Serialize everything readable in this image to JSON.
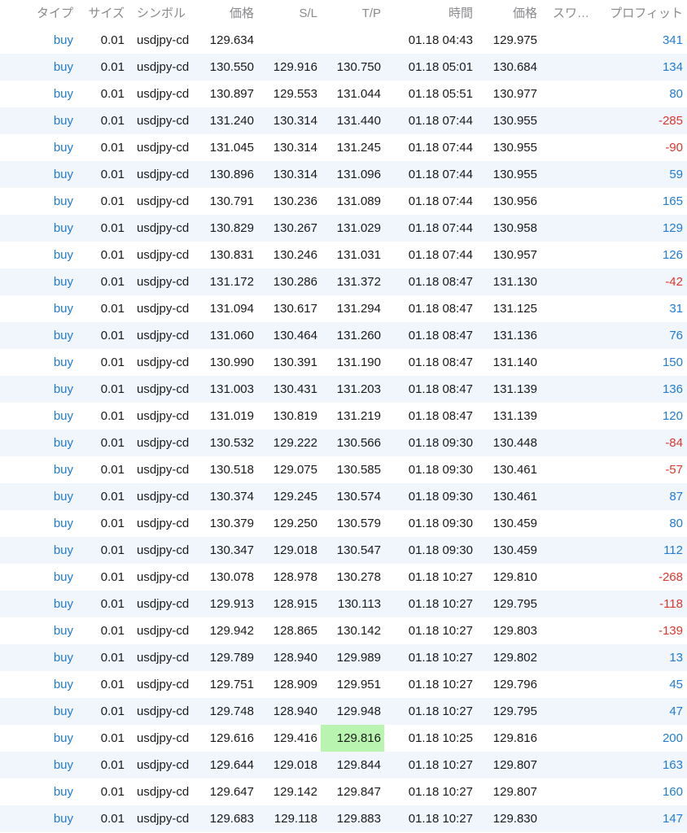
{
  "header": {
    "type": "タイプ",
    "size": "サイズ",
    "symbol": "シンボル",
    "price": "価格",
    "sl": "S/L",
    "tp": "T/P",
    "time": "時間",
    "current_price": "価格",
    "swap": "スワ…",
    "profit": "プロフィット"
  },
  "colors": {
    "buy": "#1f7bd6",
    "profit_positive": "#1f7bd6",
    "profit_negative": "#e0362c",
    "row_alternate": "#f1f6fd",
    "tp_highlight": "#b9f5b0"
  },
  "rows": [
    {
      "type": "buy",
      "size": "0.01",
      "symbol": "usdjpy-cd",
      "price": "129.634",
      "sl": "",
      "tp": "",
      "time": "01.18 04:43",
      "current_price": "129.975",
      "swap": "",
      "profit": "341"
    },
    {
      "type": "buy",
      "size": "0.01",
      "symbol": "usdjpy-cd",
      "price": "130.550",
      "sl": "129.916",
      "tp": "130.750",
      "time": "01.18 05:01",
      "current_price": "130.684",
      "swap": "",
      "profit": "134"
    },
    {
      "type": "buy",
      "size": "0.01",
      "symbol": "usdjpy-cd",
      "price": "130.897",
      "sl": "129.553",
      "tp": "131.044",
      "time": "01.18 05:51",
      "current_price": "130.977",
      "swap": "",
      "profit": "80"
    },
    {
      "type": "buy",
      "size": "0.01",
      "symbol": "usdjpy-cd",
      "price": "131.240",
      "sl": "130.314",
      "tp": "131.440",
      "time": "01.18 07:44",
      "current_price": "130.955",
      "swap": "",
      "profit": "-285"
    },
    {
      "type": "buy",
      "size": "0.01",
      "symbol": "usdjpy-cd",
      "price": "131.045",
      "sl": "130.314",
      "tp": "131.245",
      "time": "01.18 07:44",
      "current_price": "130.955",
      "swap": "",
      "profit": "-90"
    },
    {
      "type": "buy",
      "size": "0.01",
      "symbol": "usdjpy-cd",
      "price": "130.896",
      "sl": "130.314",
      "tp": "131.096",
      "time": "01.18 07:44",
      "current_price": "130.955",
      "swap": "",
      "profit": "59"
    },
    {
      "type": "buy",
      "size": "0.01",
      "symbol": "usdjpy-cd",
      "price": "130.791",
      "sl": "130.236",
      "tp": "131.089",
      "time": "01.18 07:44",
      "current_price": "130.956",
      "swap": "",
      "profit": "165"
    },
    {
      "type": "buy",
      "size": "0.01",
      "symbol": "usdjpy-cd",
      "price": "130.829",
      "sl": "130.267",
      "tp": "131.029",
      "time": "01.18 07:44",
      "current_price": "130.958",
      "swap": "",
      "profit": "129"
    },
    {
      "type": "buy",
      "size": "0.01",
      "symbol": "usdjpy-cd",
      "price": "130.831",
      "sl": "130.246",
      "tp": "131.031",
      "time": "01.18 07:44",
      "current_price": "130.957",
      "swap": "",
      "profit": "126"
    },
    {
      "type": "buy",
      "size": "0.01",
      "symbol": "usdjpy-cd",
      "price": "131.172",
      "sl": "130.286",
      "tp": "131.372",
      "time": "01.18 08:47",
      "current_price": "131.130",
      "swap": "",
      "profit": "-42"
    },
    {
      "type": "buy",
      "size": "0.01",
      "symbol": "usdjpy-cd",
      "price": "131.094",
      "sl": "130.617",
      "tp": "131.294",
      "time": "01.18 08:47",
      "current_price": "131.125",
      "swap": "",
      "profit": "31"
    },
    {
      "type": "buy",
      "size": "0.01",
      "symbol": "usdjpy-cd",
      "price": "131.060",
      "sl": "130.464",
      "tp": "131.260",
      "time": "01.18 08:47",
      "current_price": "131.136",
      "swap": "",
      "profit": "76"
    },
    {
      "type": "buy",
      "size": "0.01",
      "symbol": "usdjpy-cd",
      "price": "130.990",
      "sl": "130.391",
      "tp": "131.190",
      "time": "01.18 08:47",
      "current_price": "131.140",
      "swap": "",
      "profit": "150"
    },
    {
      "type": "buy",
      "size": "0.01",
      "symbol": "usdjpy-cd",
      "price": "131.003",
      "sl": "130.431",
      "tp": "131.203",
      "time": "01.18 08:47",
      "current_price": "131.139",
      "swap": "",
      "profit": "136"
    },
    {
      "type": "buy",
      "size": "0.01",
      "symbol": "usdjpy-cd",
      "price": "131.019",
      "sl": "130.819",
      "tp": "131.219",
      "time": "01.18 08:47",
      "current_price": "131.139",
      "swap": "",
      "profit": "120"
    },
    {
      "type": "buy",
      "size": "0.01",
      "symbol": "usdjpy-cd",
      "price": "130.532",
      "sl": "129.222",
      "tp": "130.566",
      "time": "01.18 09:30",
      "current_price": "130.448",
      "swap": "",
      "profit": "-84"
    },
    {
      "type": "buy",
      "size": "0.01",
      "symbol": "usdjpy-cd",
      "price": "130.518",
      "sl": "129.075",
      "tp": "130.585",
      "time": "01.18 09:30",
      "current_price": "130.461",
      "swap": "",
      "profit": "-57"
    },
    {
      "type": "buy",
      "size": "0.01",
      "symbol": "usdjpy-cd",
      "price": "130.374",
      "sl": "129.245",
      "tp": "130.574",
      "time": "01.18 09:30",
      "current_price": "130.461",
      "swap": "",
      "profit": "87"
    },
    {
      "type": "buy",
      "size": "0.01",
      "symbol": "usdjpy-cd",
      "price": "130.379",
      "sl": "129.250",
      "tp": "130.579",
      "time": "01.18 09:30",
      "current_price": "130.459",
      "swap": "",
      "profit": "80"
    },
    {
      "type": "buy",
      "size": "0.01",
      "symbol": "usdjpy-cd",
      "price": "130.347",
      "sl": "129.018",
      "tp": "130.547",
      "time": "01.18 09:30",
      "current_price": "130.459",
      "swap": "",
      "profit": "112"
    },
    {
      "type": "buy",
      "size": "0.01",
      "symbol": "usdjpy-cd",
      "price": "130.078",
      "sl": "128.978",
      "tp": "130.278",
      "time": "01.18 10:27",
      "current_price": "129.810",
      "swap": "",
      "profit": "-268"
    },
    {
      "type": "buy",
      "size": "0.01",
      "symbol": "usdjpy-cd",
      "price": "129.913",
      "sl": "128.915",
      "tp": "130.113",
      "time": "01.18 10:27",
      "current_price": "129.795",
      "swap": "",
      "profit": "-118"
    },
    {
      "type": "buy",
      "size": "0.01",
      "symbol": "usdjpy-cd",
      "price": "129.942",
      "sl": "128.865",
      "tp": "130.142",
      "time": "01.18 10:27",
      "current_price": "129.803",
      "swap": "",
      "profit": "-139"
    },
    {
      "type": "buy",
      "size": "0.01",
      "symbol": "usdjpy-cd",
      "price": "129.789",
      "sl": "128.940",
      "tp": "129.989",
      "time": "01.18 10:27",
      "current_price": "129.802",
      "swap": "",
      "profit": "13"
    },
    {
      "type": "buy",
      "size": "0.01",
      "symbol": "usdjpy-cd",
      "price": "129.751",
      "sl": "128.909",
      "tp": "129.951",
      "time": "01.18 10:27",
      "current_price": "129.796",
      "swap": "",
      "profit": "45"
    },
    {
      "type": "buy",
      "size": "0.01",
      "symbol": "usdjpy-cd",
      "price": "129.748",
      "sl": "128.940",
      "tp": "129.948",
      "time": "01.18 10:27",
      "current_price": "129.795",
      "swap": "",
      "profit": "47"
    },
    {
      "type": "buy",
      "size": "0.01",
      "symbol": "usdjpy-cd",
      "price": "129.616",
      "sl": "129.416",
      "tp": "129.816",
      "time": "01.18 10:25",
      "current_price": "129.816",
      "swap": "",
      "profit": "200",
      "tp_highlighted": true
    },
    {
      "type": "buy",
      "size": "0.01",
      "symbol": "usdjpy-cd",
      "price": "129.644",
      "sl": "129.018",
      "tp": "129.844",
      "time": "01.18 10:27",
      "current_price": "129.807",
      "swap": "",
      "profit": "163"
    },
    {
      "type": "buy",
      "size": "0.01",
      "symbol": "usdjpy-cd",
      "price": "129.647",
      "sl": "129.142",
      "tp": "129.847",
      "time": "01.18 10:27",
      "current_price": "129.807",
      "swap": "",
      "profit": "160"
    },
    {
      "type": "buy",
      "size": "0.01",
      "symbol": "usdjpy-cd",
      "price": "129.683",
      "sl": "129.118",
      "tp": "129.883",
      "time": "01.18 10:27",
      "current_price": "129.830",
      "swap": "",
      "profit": "147"
    }
  ]
}
